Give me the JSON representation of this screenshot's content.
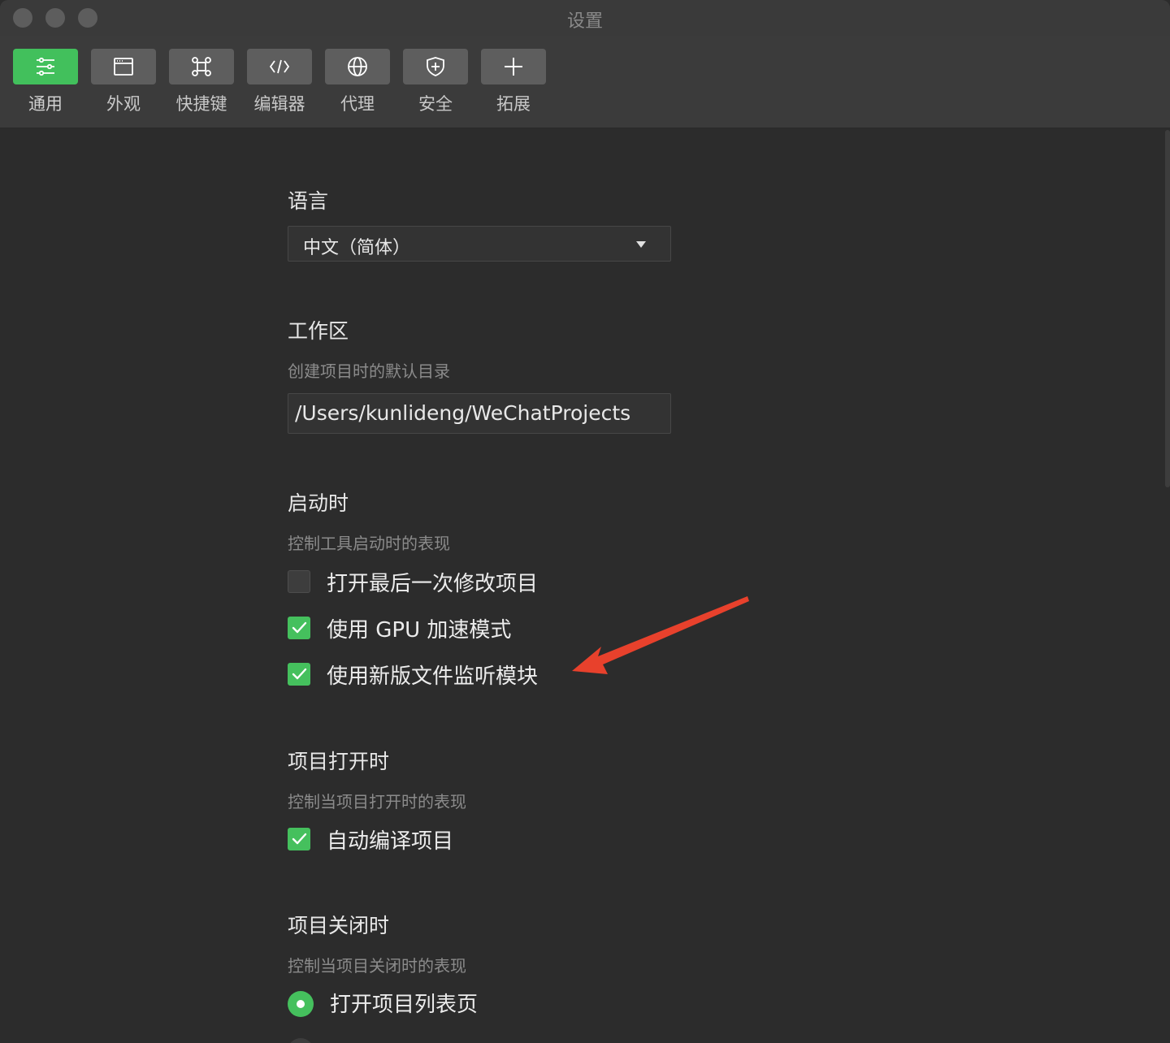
{
  "window": {
    "title": "设置"
  },
  "toolbar": {
    "items": [
      {
        "label": "通用",
        "icon": "sliders-icon",
        "active": true
      },
      {
        "label": "外观",
        "icon": "window-icon",
        "active": false
      },
      {
        "label": "快捷键",
        "icon": "command-key-icon",
        "active": false
      },
      {
        "label": "编辑器",
        "icon": "code-icon",
        "active": false
      },
      {
        "label": "代理",
        "icon": "globe-icon",
        "active": false
      },
      {
        "label": "安全",
        "icon": "shield-icon",
        "active": false
      },
      {
        "label": "拓展",
        "icon": "plus-icon",
        "active": false
      }
    ]
  },
  "language": {
    "title": "语言",
    "selected": "中文（简体）"
  },
  "workspace": {
    "title": "工作区",
    "desc": "创建项目时的默认目录",
    "path": "/Users/kunlideng/WeChatProjects"
  },
  "startup": {
    "title": "启动时",
    "desc": "控制工具启动时的表现",
    "options": [
      {
        "label": "打开最后一次修改项目",
        "checked": false
      },
      {
        "label": "使用 GPU 加速模式",
        "checked": true
      },
      {
        "label": "使用新版文件监听模块",
        "checked": true
      }
    ]
  },
  "project_open": {
    "title": "项目打开时",
    "desc": "控制当项目打开时的表现",
    "options": [
      {
        "label": "自动编译项目",
        "checked": true
      }
    ]
  },
  "project_close": {
    "title": "项目关闭时",
    "desc": "控制当项目关闭时的表现",
    "options": [
      {
        "label": "打开项目列表页",
        "selected": true
      }
    ]
  },
  "colors": {
    "accent": "#42c05c",
    "background": "#2c2c2c",
    "annotation_arrow": "#e8412c"
  }
}
